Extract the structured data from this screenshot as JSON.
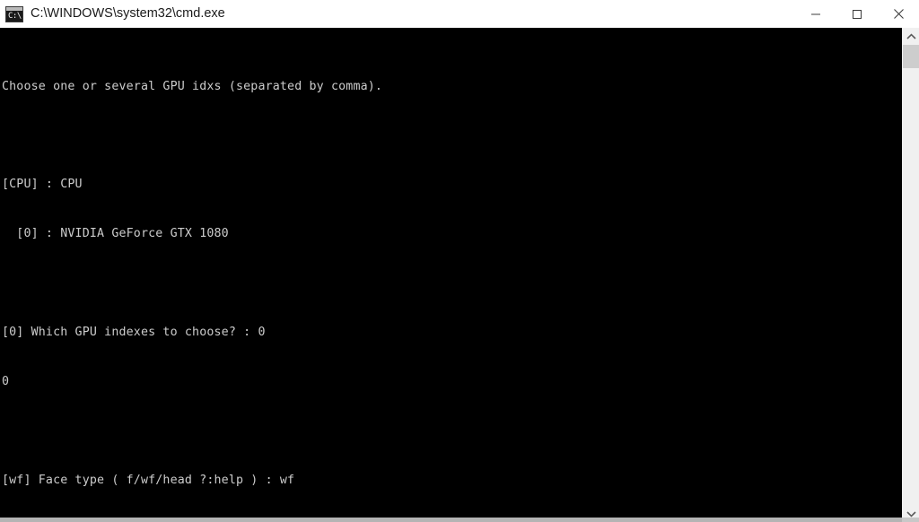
{
  "window": {
    "title": "C:\\WINDOWS\\system32\\cmd.exe",
    "icon_name": "cmd-console-icon",
    "icon_label": "C:\\",
    "background": "#000000",
    "titlebar_background": "#ffffff",
    "titlebar_text_color": "#1a1a1a"
  },
  "controls": {
    "minimize_label": "Minimize",
    "maximize_label": "Maximize",
    "close_label": "Close"
  },
  "console": {
    "foreground": "#cccccc",
    "background": "#000000",
    "lines": [
      "Choose one or several GPU idxs (separated by comma).",
      "",
      "[CPU] : CPU",
      "  [0] : NVIDIA GeForce GTX 1080",
      "",
      "[0] Which GPU indexes to choose? : 0",
      "0",
      "",
      "[wf] Face type ( f/wf/head ?:help ) : wf"
    ],
    "prompts": [
      {
        "key": "gpu_indexes",
        "default": "0",
        "question": "[0] Which GPU indexes to choose? : 0",
        "answer": "0"
      },
      {
        "key": "face_type",
        "default": "wf",
        "question": "[wf] Face type ( f/wf/head ?:help ) : wf",
        "answer": "wf",
        "options": [
          "f",
          "wf",
          "head",
          "?:help"
        ]
      }
    ],
    "devices": [
      {
        "id": "CPU",
        "name": "CPU"
      },
      {
        "id": "0",
        "name": "NVIDIA GeForce GTX 1080"
      }
    ]
  },
  "scrollbar": {
    "up_arrow_name": "scroll-up",
    "down_arrow_name": "scroll-down",
    "thumb_name": "scroll-thumb",
    "track_color": "#f0f0f0",
    "thumb_color": "#cdcdcd"
  }
}
